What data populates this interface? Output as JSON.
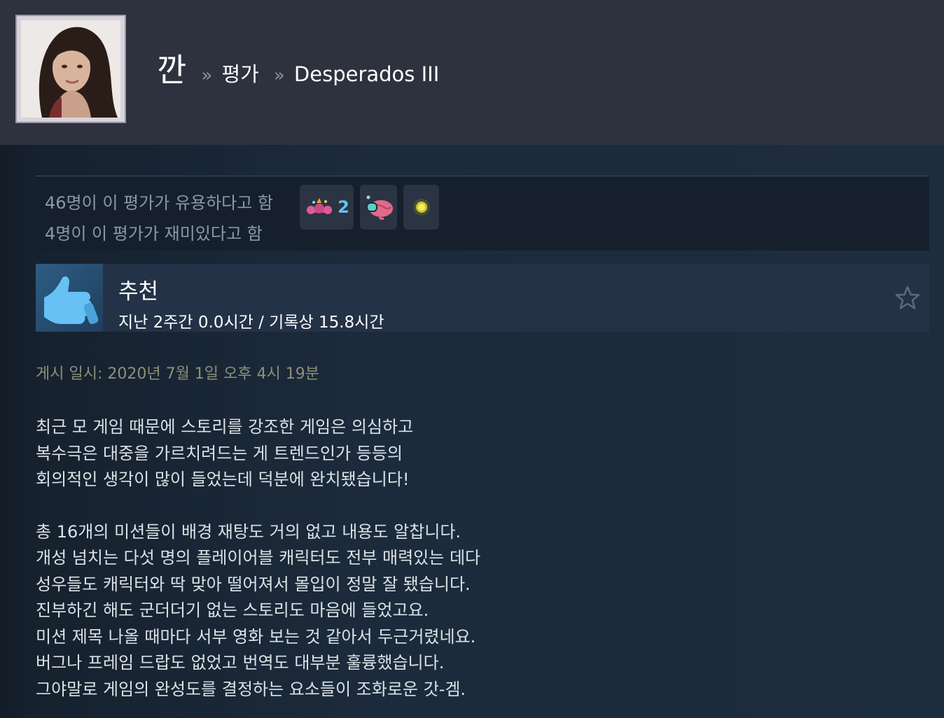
{
  "header": {
    "user_name": "깐",
    "separator": "»",
    "crumb_reviews": "평가",
    "crumb_game": "Desperados III"
  },
  "stats": {
    "helpful_line": "46명이 이 평가가 유용하다고 함",
    "funny_line": "4명이 이 평가가 재미있다고 함",
    "awards": [
      {
        "icon": "confetti-award-icon",
        "count": "2"
      },
      {
        "icon": "brain-goggles-award-icon",
        "count": ""
      },
      {
        "icon": "golden-dot-award-icon",
        "count": ""
      }
    ]
  },
  "review": {
    "verdict": "추천",
    "hours": "지난 2주간 0.0시간 / 기록상 15.8시간",
    "posted": "게시 일시: 2020년 7월 1일 오후 4시 19분",
    "paragraph1": [
      "최근 모 게임 때문에 스토리를 강조한 게임은 의심하고",
      "복수극은 대중을 가르치려드는 게 트렌드인가 등등의",
      "회의적인 생각이 많이 들었는데 덕분에 완치됐습니다!"
    ],
    "paragraph2": [
      "총 16개의 미션들이 배경 재탕도 거의 없고 내용도 알찹니다.",
      "개성 넘치는 다섯 명의 플레이어블 캐릭터도 전부 매력있는 데다",
      "성우들도 캐릭터와 딱 맞아 떨어져서 몰입이 정말 잘 됐습니다.",
      "진부하긴 해도 군더더기 없는 스토리도 마음에 들었고요.",
      "미션 제목 나올 때마다 서부 영화 보는 것 같아서 두근거렸네요.",
      "버그나 프레임 드랍도 없었고 번역도 대부분 훌륭했습니다.",
      "그야말로 게임의 완성도를 결정하는 요소들이 조화로운 갓-겜."
    ]
  },
  "colors": {
    "background": "#1b2838",
    "header": "#2e323f",
    "accent_blue": "#66c0f4",
    "posted_text": "#8c9178"
  }
}
